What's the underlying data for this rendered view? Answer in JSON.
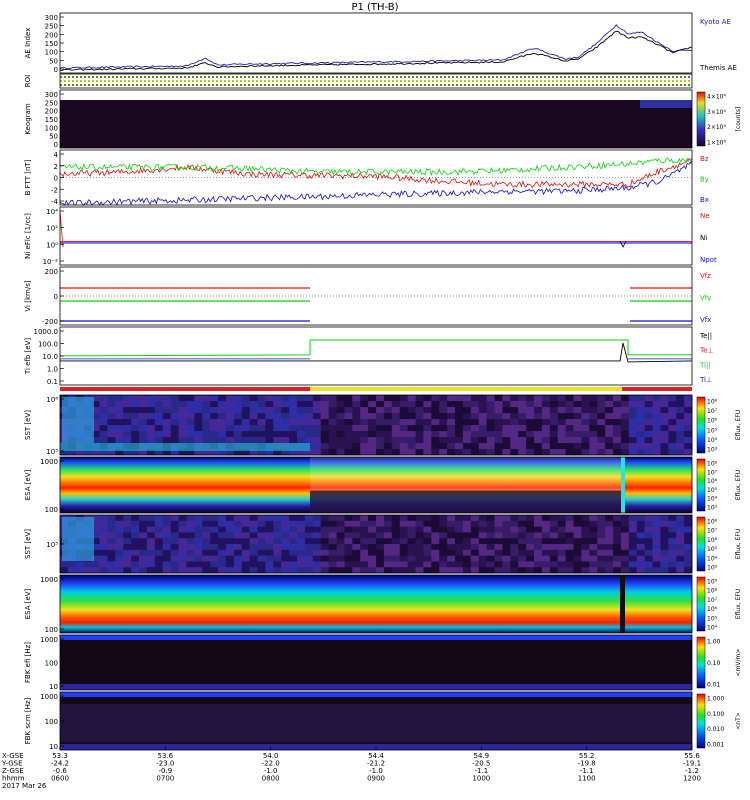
{
  "title": "P1 (TH-B)",
  "date": "2017 Mar 26",
  "colors": {
    "kyoto": "#2020b0",
    "themis": "#000000",
    "red": "#e01010",
    "green": "#10d010",
    "blue": "#1010d0",
    "black": "#000000",
    "bar_red": "#e02020",
    "bar_yellow": "#f0e020"
  },
  "chart_data": {
    "type": "line",
    "x_axis": {
      "rows": [
        {
          "label": "X-GSE",
          "values": [
            "53.3",
            "53.6",
            "54.0",
            "54.4",
            "54.9",
            "55.2",
            "55.6"
          ]
        },
        {
          "label": "Y-GSE",
          "values": [
            "-24.2",
            "-23.0",
            "-22.0",
            "-21.2",
            "-20.5",
            "-19.8",
            "-19.1"
          ]
        },
        {
          "label": "Z-GSE",
          "values": [
            "-0.6",
            "-0.9",
            "-1.0",
            "-1.0",
            "-1.1",
            "-1.1",
            "-1.2"
          ]
        },
        {
          "label": "hhmm",
          "values": [
            "0600",
            "0700",
            "0800",
            "0900",
            "1000",
            "1100",
            "1200"
          ]
        }
      ]
    },
    "panels": [
      {
        "id": "ae",
        "ylabel": "AE Index",
        "ticks": [
          "300",
          "250",
          "200",
          "150",
          "100",
          "50",
          "0"
        ],
        "ylim": [
          0,
          300
        ],
        "legend": [
          "Kyoto AE",
          "Themis AE"
        ],
        "series": [
          {
            "name": "Kyoto AE",
            "x": [
              0,
              0.1,
              0.2,
              0.23,
              0.25,
              0.3,
              0.4,
              0.5,
              0.6,
              0.7,
              0.75,
              0.8,
              0.82,
              0.85,
              0.88,
              0.9,
              0.92,
              0.95,
              0.97,
              1.0
            ],
            "values": [
              25,
              30,
              35,
              75,
              40,
              45,
              50,
              55,
              60,
              65,
              125,
              70,
              80,
              150,
              240,
              195,
              205,
              145,
              110,
              115
            ]
          },
          {
            "name": "Themis AE",
            "x": [
              0,
              0.1,
              0.2,
              0.23,
              0.25,
              0.3,
              0.4,
              0.5,
              0.6,
              0.7,
              0.75,
              0.8,
              0.82,
              0.85,
              0.88,
              0.9,
              0.92,
              0.95,
              0.97,
              1.0
            ],
            "values": [
              15,
              20,
              25,
              50,
              30,
              35,
              40,
              45,
              50,
              55,
              100,
              60,
              70,
              130,
              210,
              175,
              180,
              135,
              100,
              130
            ]
          }
        ]
      },
      {
        "id": "roi",
        "ylabel": "ROI"
      },
      {
        "id": "keogram",
        "ylabel": "Keogram",
        "ticks": [
          "300",
          "250",
          "200",
          "150",
          "100",
          "50",
          "0"
        ],
        "colorbar": {
          "labels": [
            "4×10⁴",
            "3×10⁴",
            "2×10⁴",
            "1×10⁴"
          ],
          "title": "[counts]"
        }
      },
      {
        "id": "bfield",
        "ylabel": "B FTT [nT]",
        "ticks": [
          "4",
          "2",
          "0",
          "-2",
          "-4"
        ],
        "ylim": [
          -4,
          4
        ],
        "legend": [
          "Bz",
          "By",
          "Bx"
        ],
        "series": [
          {
            "name": "Bz",
            "x": [
              0,
              0.1,
              0.2,
              0.3,
              0.4,
              0.5,
              0.6,
              0.7,
              0.8,
              0.9,
              0.95,
              1.0
            ],
            "values": [
              0.5,
              0.8,
              1.5,
              0.5,
              0.3,
              0.2,
              -0.5,
              -1.0,
              -1.0,
              -1.0,
              1.0,
              2.5
            ]
          },
          {
            "name": "By",
            "x": [
              0,
              0.1,
              0.2,
              0.3,
              0.4,
              0.5,
              0.6,
              0.7,
              0.8,
              0.9,
              0.95,
              1.0
            ],
            "values": [
              1.5,
              1.5,
              1.5,
              1.3,
              0.8,
              0.8,
              0.8,
              1.0,
              1.5,
              2.0,
              2.5,
              2.5
            ]
          },
          {
            "name": "Bx",
            "x": [
              0,
              0.1,
              0.2,
              0.3,
              0.4,
              0.5,
              0.6,
              0.7,
              0.8,
              0.9,
              0.95,
              1.0
            ],
            "values": [
              -3.8,
              -3.5,
              -3.3,
              -3.0,
              -2.8,
              -2.5,
              -2.3,
              -2.0,
              -2.0,
              -1.5,
              -0.5,
              2.0
            ]
          }
        ]
      },
      {
        "id": "density",
        "ylabel": "Ni eFlc [1/cc]",
        "ticks": [
          "10⁴",
          "10²",
          "10⁰",
          "10⁻²"
        ],
        "legend": [
          "Ne",
          "Ni",
          "Npot"
        ]
      },
      {
        "id": "velocity",
        "ylabel": "Vi [km/s]",
        "ticks": [
          "200",
          "0",
          "-200"
        ],
        "legend": [
          "Vfz",
          "Vfy",
          "Vfx"
        ]
      },
      {
        "id": "temperature",
        "ylabel": "Ti efb [eV]",
        "ticks": [
          "1000.0",
          "100.0",
          "10.0",
          "1.0",
          "0.1"
        ],
        "legend": [
          "Te||",
          "Te⊥",
          "Ti||",
          "Ti⊥"
        ]
      },
      {
        "id": "sst1",
        "ylabel": "SST [eV]",
        "ticks": [
          "10⁶",
          "10⁵"
        ],
        "colorbar": {
          "labels": [
            "10⁸",
            "10⁷",
            "10⁶",
            "10⁵",
            "10⁴",
            "10³"
          ],
          "title": "Eflux, EFU"
        }
      },
      {
        "id": "esa1",
        "ylabel": "ESA [eV]",
        "ticks": [
          "1000",
          "100"
        ],
        "colorbar": {
          "labels": [
            "10⁸",
            "10⁷",
            "10⁶",
            "10⁵",
            "10⁴",
            "10³"
          ],
          "title": "Eflux, EFU"
        }
      },
      {
        "id": "sst2",
        "ylabel": "SST [eV]",
        "ticks": [
          "10⁵"
        ],
        "colorbar": {
          "labels": [
            "10⁸",
            "10⁷",
            "10⁶",
            "10⁵",
            "10⁴",
            "10³"
          ],
          "title": "Eflux, EFU"
        }
      },
      {
        "id": "esa2",
        "ylabel": "ESA [eV]",
        "ticks": [
          "1000",
          "100"
        ],
        "colorbar": {
          "labels": [
            "10⁹",
            "10⁸",
            "10⁷",
            "10⁶",
            "10⁵",
            "10⁴"
          ],
          "title": "Eflux, EFU"
        }
      },
      {
        "id": "fbk1",
        "ylabel": "FBK efi [Hz]",
        "ticks": [
          "1000",
          "100",
          "10"
        ],
        "colorbar": {
          "labels": [
            "1.00",
            "0.10",
            "0.01"
          ],
          "title": "<mV/m>"
        }
      },
      {
        "id": "fbk2",
        "ylabel": "FBK scm [Hz]",
        "ticks": [
          "1000",
          "100",
          "10"
        ],
        "colorbar": {
          "labels": [
            "1.000",
            "0.100",
            "0.010",
            "0.001"
          ],
          "title": "<nT>"
        }
      }
    ]
  }
}
